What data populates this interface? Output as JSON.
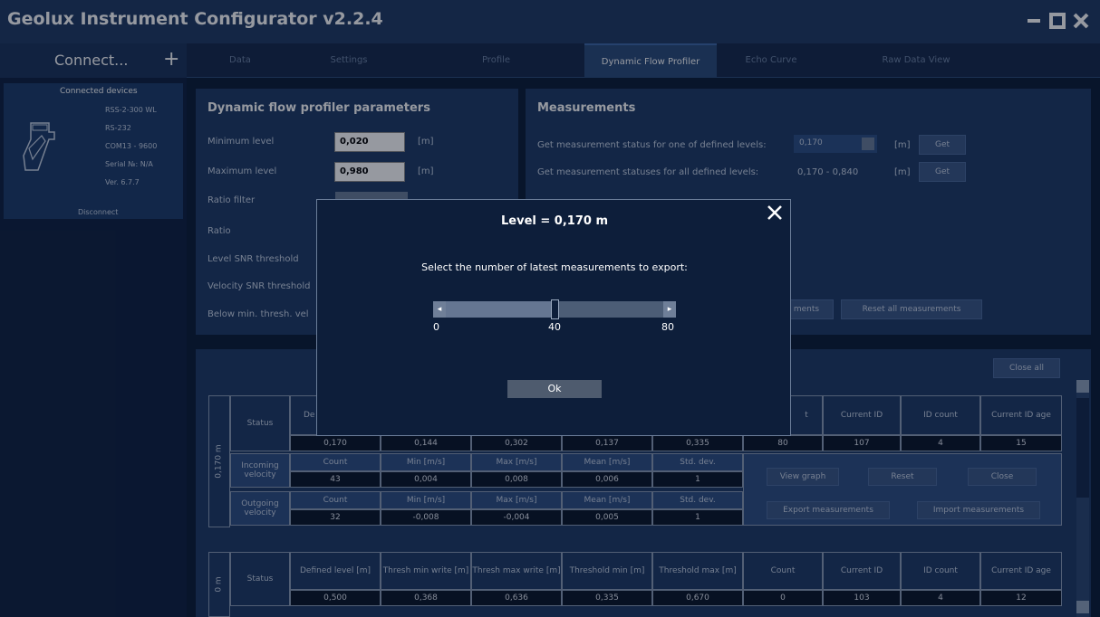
{
  "window": {
    "title": "Geolux Instrument Configurator v2.2.4",
    "min_icon": "minimize-icon",
    "max_icon": "maximize-icon",
    "close_icon": "close-icon"
  },
  "connect": {
    "label": "Connect...",
    "plus": "+"
  },
  "tabs": [
    {
      "label": "Data",
      "active": false
    },
    {
      "label": "Settings",
      "active": false
    },
    {
      "label": "Profile",
      "active": false
    },
    {
      "label": "Dynamic Flow Profiler",
      "active": true
    },
    {
      "label": "Echo Curve",
      "active": false
    },
    {
      "label": "Raw Data View",
      "active": false
    }
  ],
  "sidebar": {
    "heading": "Connected devices",
    "device": {
      "model": "RSS-2-300 WL",
      "interface": "RS-232",
      "port": "COM13 - 9600",
      "serial": "Serial №: N/A",
      "version": "Ver. 6.7.7"
    },
    "disconnect": "Disconnect"
  },
  "params": {
    "title": "Dynamic flow profiler parameters",
    "min_level_label": "Minimum level",
    "min_level_value": "0,020",
    "unit_m": "[m]",
    "max_level_label": "Maximum level",
    "max_level_value": "0,980",
    "ratio_filter_label": "Ratio filter",
    "ratio_label": "Ratio",
    "level_snr_label": "Level SNR threshold",
    "velocity_snr_label": "Velocity SNR threshold",
    "below_min_label": "Below min. thresh. vel"
  },
  "measurements": {
    "title": "Measurements",
    "status_one_label": "Get measurement status for one of defined levels:",
    "selected_level": "0,170",
    "unit_m": "[m]",
    "get_label": "Get",
    "status_all_label": "Get measurement statuses for all defined levels:",
    "range_value": "0,170 - 0,840",
    "import_label": "ments",
    "reset_all_label": "Reset all measurements"
  },
  "results": {
    "close_all": "Close all",
    "status_label": "Status",
    "side_label_1": "0,170 m",
    "side_label_2": "0 m",
    "block1": {
      "header_partial": "De",
      "header_count_partial": "t",
      "current_id": "Current ID",
      "id_count": "ID count",
      "current_id_age": "Current ID age",
      "values": [
        "0,170",
        "0,144",
        "0,302",
        "0,137",
        "0,335",
        "80",
        "107",
        "4",
        "15"
      ],
      "incoming_label": "Incoming velocity",
      "outgoing_label": "Outgoing velocity",
      "stat_headers": [
        "Count",
        "Min [m/s]",
        "Max [m/s]",
        "Mean [m/s]",
        "Std. dev."
      ],
      "incoming_values": [
        "43",
        "0,004",
        "0,008",
        "0,006",
        "1"
      ],
      "outgoing_values": [
        "32",
        "-0,008",
        "-0,004",
        "0,005",
        "1"
      ],
      "view_graph": "View graph",
      "reset": "Reset",
      "close": "Close",
      "export": "Export measurements",
      "import": "Import measurements"
    },
    "block2": {
      "headers": [
        "Defined level [m]",
        "Thresh min write [m]",
        "Thresh max write [m]",
        "Threshold min [m]",
        "Threshold max [m]",
        "Count",
        "Current ID",
        "ID count",
        "Current ID age"
      ],
      "values": [
        "0,500",
        "0,368",
        "0,636",
        "0,335",
        "0,670",
        "0",
        "103",
        "4",
        "12"
      ]
    }
  },
  "modal": {
    "title": "Level = 0,170 m",
    "text": "Select the number of latest measurements to export:",
    "slider_min": "0",
    "slider_value": "40",
    "slider_max": "80",
    "slider_fraction": 0.5,
    "ok": "Ok",
    "close_icon": "close-icon"
  }
}
